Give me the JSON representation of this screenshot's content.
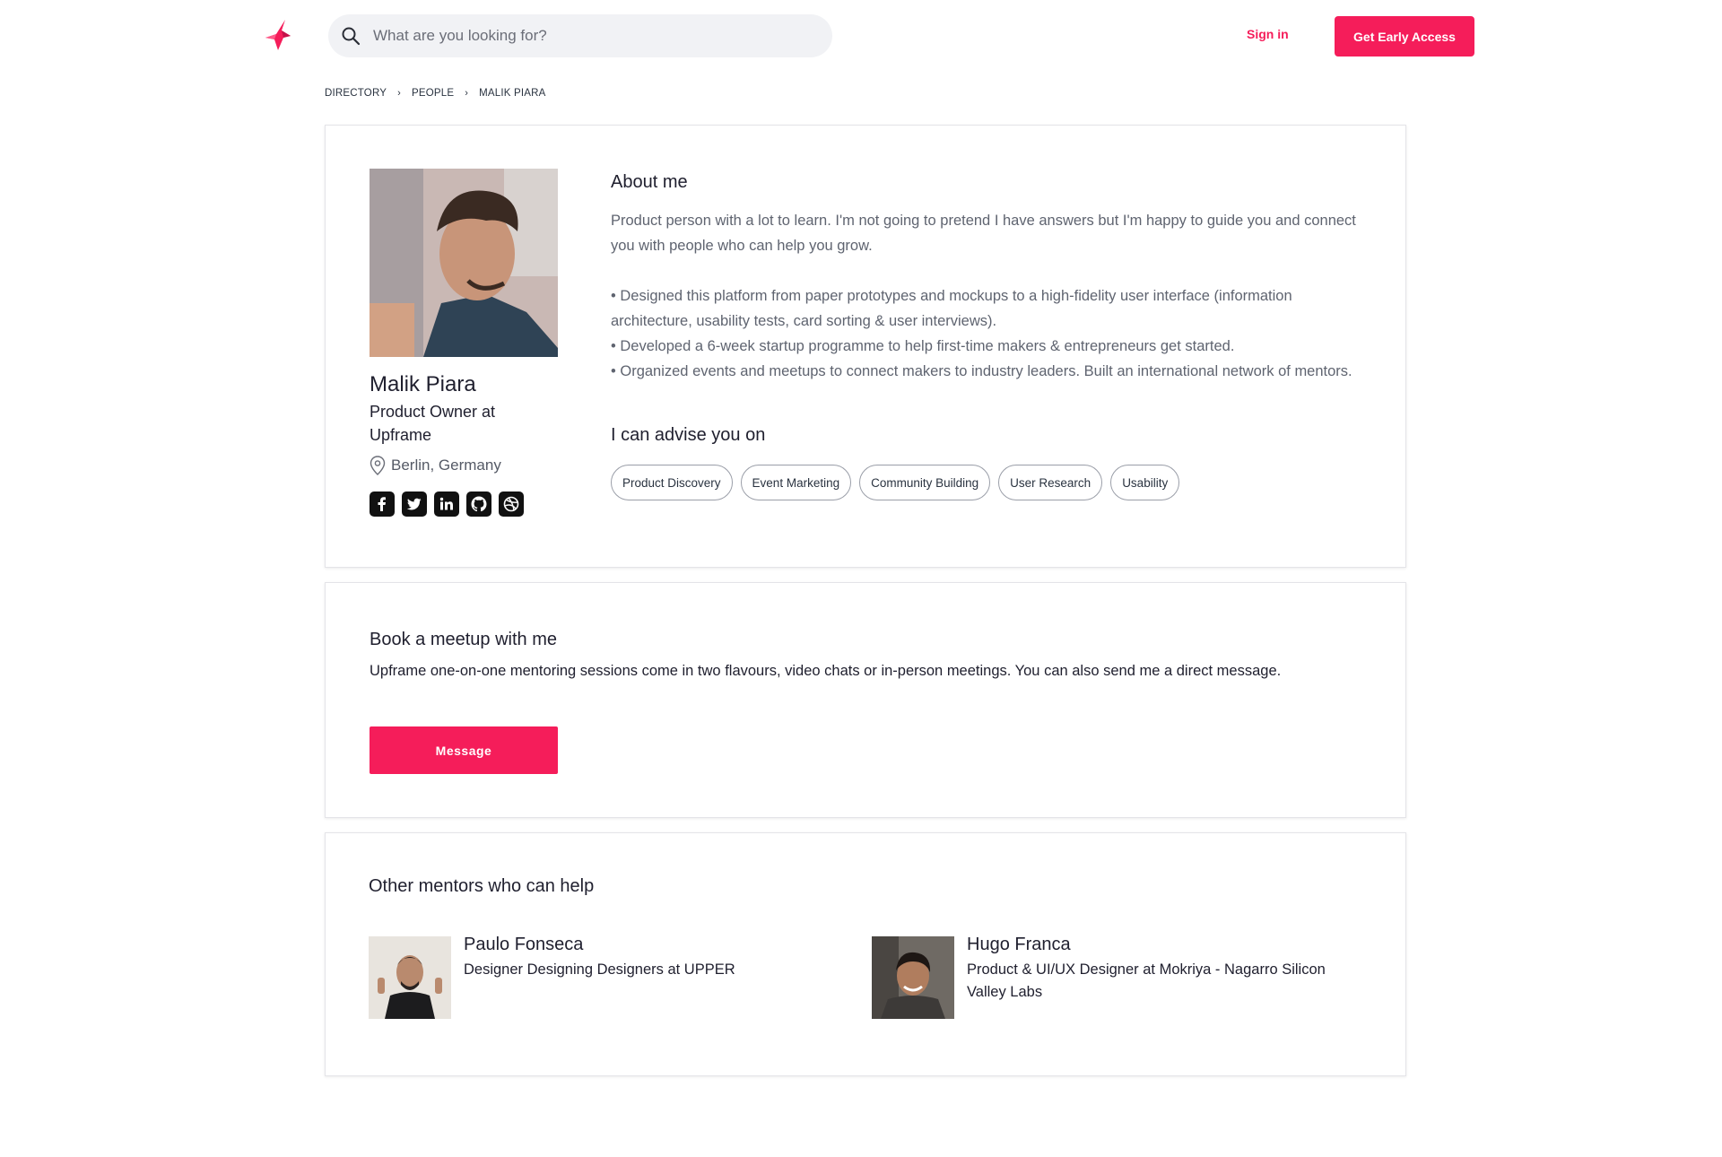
{
  "header": {
    "search_placeholder": "What are you looking for?",
    "signin_label": "Sign in",
    "cta_label": "Get Early Access",
    "accent_color": "#f51d5a"
  },
  "breadcrumb": [
    "DIRECTORY",
    "PEOPLE",
    "MALIK PIARA"
  ],
  "profile": {
    "name": "Malik Piara",
    "role": "Product Owner at Upframe",
    "location": "Berlin, Germany",
    "socials": [
      "facebook-icon",
      "twitter-icon",
      "linkedin-icon",
      "github-icon",
      "dribbble-icon"
    ],
    "about_title": "About me",
    "about_intro": "Product person with a lot to learn. I'm not going to pretend I have answers but I'm happy to guide you and connect you with people who can help you grow.",
    "about_bullets": [
      "• Designed this platform from paper prototypes and mockups to a high-fidelity user interface (information architecture, usability tests, card sorting & user interviews).",
      "• Developed a 6-week startup programme to help first-time makers & entrepreneurs get started.",
      "• Organized events and meetups to connect makers to industry leaders. Built an international network of mentors."
    ],
    "advise_title": "I can advise you on",
    "tags": [
      "Product Discovery",
      "Event Marketing",
      "Community Building",
      "User Research",
      "Usability"
    ]
  },
  "book": {
    "title": "Book a meetup with me",
    "text": "Upframe one-on-one mentoring sessions come in two flavours, video chats or in-person meetings. You can also send me a direct message.",
    "button_label": "Message"
  },
  "others": {
    "title": "Other mentors who can help",
    "mentors": [
      {
        "name": "Paulo Fonseca",
        "role": "Designer Designing Designers at UPPER"
      },
      {
        "name": "Hugo Franca",
        "role": "Product & UI/UX Designer at Mokriya - Nagarro Silicon Valley Labs"
      }
    ]
  }
}
